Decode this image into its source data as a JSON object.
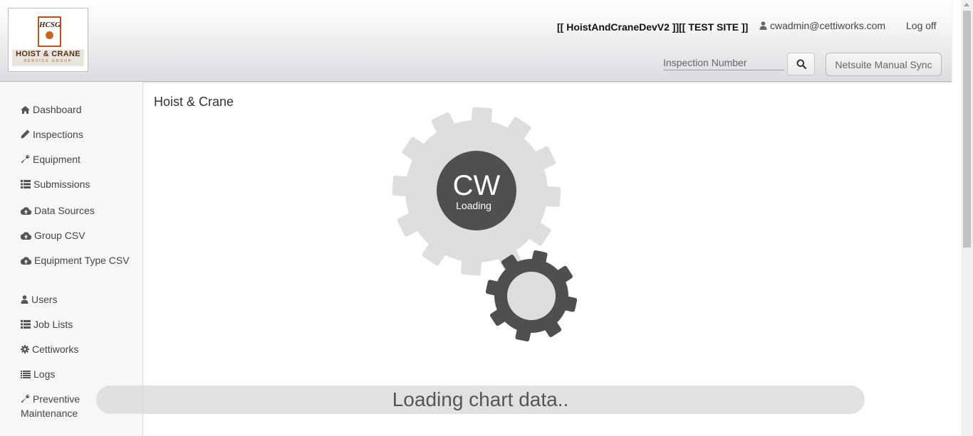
{
  "header": {
    "logo": {
      "monogram": "HCSG",
      "title": "HOIST & CRANE",
      "subtitle": "SERVICE GROUP"
    },
    "site_label": "[[ HoistAndCraneDevV2 ]][[ TEST SITE ]]",
    "user_email": "cwadmin@cettiworks.com",
    "logoff_label": "Log off",
    "search": {
      "placeholder": "Inspection Number",
      "value": ""
    },
    "sync_label": "Netsuite Manual Sync"
  },
  "sidebar": {
    "items": [
      {
        "label": "Dashboard",
        "icon": "home-icon"
      },
      {
        "label": "Inspections",
        "icon": "pencil-icon"
      },
      {
        "label": "Equipment",
        "icon": "wrench-icon"
      },
      {
        "label": "Submissions",
        "icon": "list-icon"
      },
      {
        "label": "Data Sources",
        "icon": "cloud-upload-icon"
      },
      {
        "label": "Group CSV",
        "icon": "cloud-upload-icon"
      },
      {
        "label": "Equipment Type CSV",
        "icon": "cloud-upload-icon"
      },
      {
        "label": "Users",
        "icon": "user-icon"
      },
      {
        "label": "Job Lists",
        "icon": "list-icon"
      },
      {
        "label": "Cettiworks",
        "icon": "gear-icon"
      },
      {
        "label": "Logs",
        "icon": "lines-icon"
      },
      {
        "label": "Preventive Maintenance",
        "icon": "wrench-icon"
      }
    ]
  },
  "main": {
    "title": "Hoist & Crane",
    "loader": {
      "brand": "CW",
      "text": "Loading"
    },
    "loading_message": "Loading chart data.."
  },
  "colors": {
    "gear_light": "#dedede",
    "gear_dark": "#4f4f4f",
    "logo_accent": "#b5531c"
  }
}
